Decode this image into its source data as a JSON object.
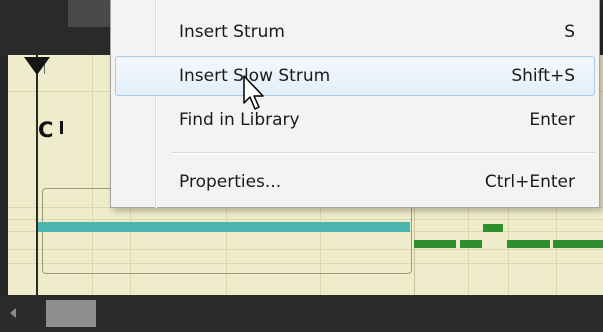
{
  "context_menu": {
    "items": [
      {
        "label": "Insert Strum",
        "shortcut": "S"
      },
      {
        "label": "Insert Slow Strum",
        "shortcut": "Shift+S",
        "highlighted": true
      },
      {
        "label": "Find in Library",
        "shortcut": "Enter"
      },
      {
        "label": "Properties...",
        "shortcut": "Ctrl+Enter"
      }
    ]
  },
  "editor": {
    "chord_label": "C"
  },
  "icons": {
    "playhead": "playhead-marker-icon",
    "cursor": "mouse-pointer-icon",
    "scroll_left": "scroll-left-arrow-icon"
  },
  "colors": {
    "editor_background": "#efeccb",
    "teal_track": "#4bb6b0",
    "green_track": "#2f8f2f",
    "menu_highlight_border": "#a8cbe9"
  }
}
